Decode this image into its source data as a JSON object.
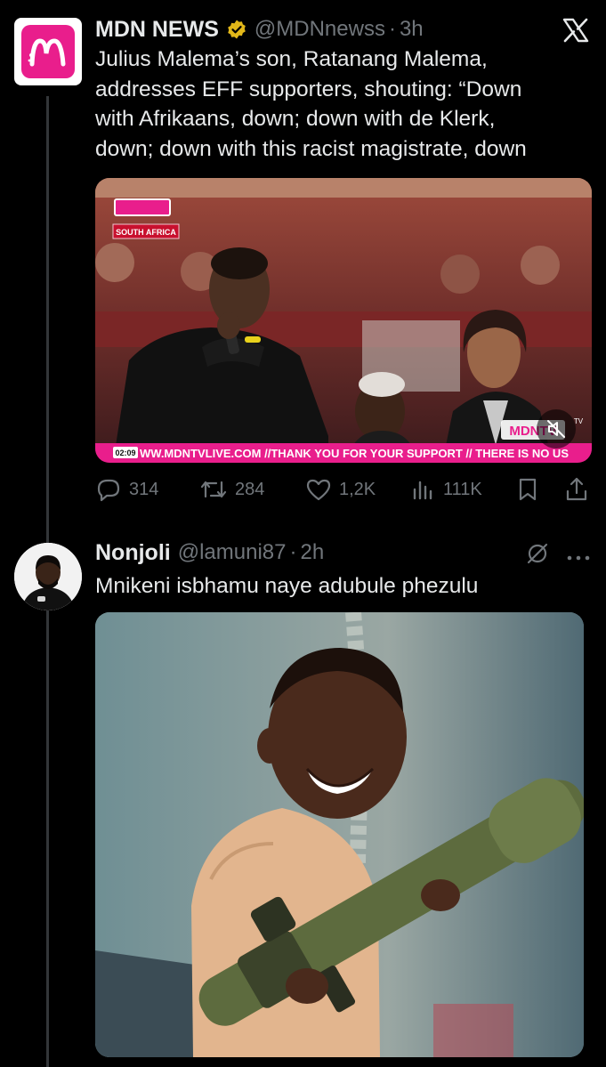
{
  "tweet1": {
    "author_name": "MDN NEWS",
    "handle": "@MDNnewss",
    "time": "3h",
    "text": "Julius Malema’s son, Ratanang Malema, addresses EFF supporters, shouting: “Down with Afrikaans, down; down with de Klerk, down; down with this racist magistrate, down",
    "avatar_letter": "M",
    "video": {
      "region_badge": "SOUTH AFRICA",
      "timestamp": "02:09",
      "ticker": "WW.MDNTVLIVE.COM //THANK YOU FOR YOUR SUPPORT // THERE IS NO US",
      "channel_logo": "MDNTV",
      "tv_mark": "TV"
    },
    "stats": {
      "replies": "314",
      "reposts": "284",
      "likes": "1,2K",
      "views": "111K"
    }
  },
  "tweet2": {
    "author_name": "Nonjoli",
    "handle": "@lamuni87",
    "time": "2h",
    "text": "Mnikeni isbhamu naye adubule phezulu"
  },
  "separator": "·",
  "colors": {
    "background": "#000000",
    "text": "#e7e9ea",
    "muted": "#71767b",
    "brand_pink": "#e91e8c",
    "verified_gold": "#e2b719"
  },
  "icons": [
    "x-logo-icon",
    "verified-badge-icon",
    "reply-icon",
    "repost-icon",
    "like-icon",
    "views-icon",
    "bookmark-icon",
    "share-icon",
    "grok-icon",
    "more-icon",
    "mute-icon"
  ]
}
